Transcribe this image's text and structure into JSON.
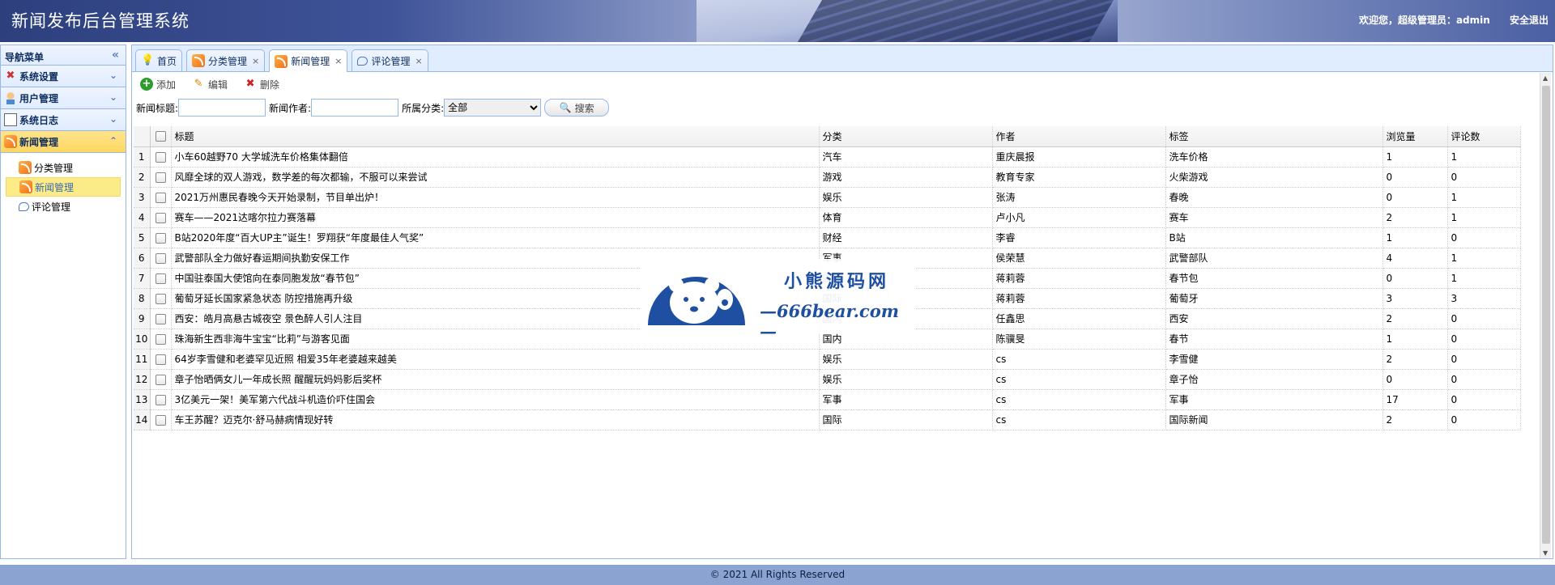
{
  "header": {
    "title": "新闻发布后台管理系统",
    "welcome": "欢迎您，超级管理员：admin",
    "logout": "安全退出"
  },
  "sidebar": {
    "title": "导航菜单",
    "sections": [
      {
        "label": "系统设置",
        "icon": "tools-icon",
        "active": false
      },
      {
        "label": "用户管理",
        "icon": "user-icon",
        "active": false
      },
      {
        "label": "系统日志",
        "icon": "log-icon",
        "active": false
      },
      {
        "label": "新闻管理",
        "icon": "rss-icon",
        "active": true
      }
    ],
    "subitems": [
      {
        "label": "分类管理",
        "icon": "rss-icon",
        "selected": false
      },
      {
        "label": "新闻管理",
        "icon": "rss-icon",
        "selected": true
      },
      {
        "label": "评论管理",
        "icon": "comment-icon",
        "selected": false
      }
    ]
  },
  "tabs": [
    {
      "label": "首页",
      "icon": "bulb-icon",
      "closable": false
    },
    {
      "label": "分类管理",
      "icon": "rss-icon",
      "closable": true
    },
    {
      "label": "新闻管理",
      "icon": "rss-icon",
      "closable": true,
      "active": true
    },
    {
      "label": "评论管理",
      "icon": "comment-icon",
      "closable": true
    }
  ],
  "toolbar": {
    "add": "添加",
    "edit": "编辑",
    "delete": "删除"
  },
  "search": {
    "title_label": "新闻标题:",
    "author_label": "新闻作者:",
    "category_label": "所属分类:",
    "category_value": "全部",
    "button": "搜索"
  },
  "table": {
    "columns": [
      "标题",
      "分类",
      "作者",
      "标签",
      "浏览量",
      "评论数"
    ],
    "rows": [
      [
        "1",
        "小车60越野70 大学城洗车价格集体翻倍",
        "汽车",
        "重庆晨报",
        "洗车价格",
        "1",
        "1"
      ],
      [
        "2",
        "风靡全球的双人游戏，数学差的每次都输，不服可以来尝试",
        "游戏",
        "教育专家",
        "火柴游戏",
        "0",
        "0"
      ],
      [
        "3",
        "2021万州惠民春晚今天开始录制，节目单出炉！",
        "娱乐",
        "张涛",
        "春晚",
        "0",
        "1"
      ],
      [
        "4",
        "赛车——2021达喀尔拉力赛落幕",
        "体育",
        "卢小凡",
        "赛车",
        "2",
        "1"
      ],
      [
        "5",
        "B站2020年度“百大UP主”诞生！罗翔获“年度最佳人气奖”",
        "财经",
        "李睿",
        "B站",
        "1",
        "0"
      ],
      [
        "6",
        "武警部队全力做好春运期间执勤安保工作",
        "军事",
        "侯荣慧",
        "武警部队",
        "4",
        "1"
      ],
      [
        "7",
        "中国驻泰国大使馆向在泰同胞发放“春节包”",
        "国际",
        "蒋莉蓉",
        "春节包",
        "0",
        "1"
      ],
      [
        "8",
        "葡萄牙延长国家紧急状态 防控措施再升级",
        "国际",
        "蒋莉蓉",
        "葡萄牙",
        "3",
        "3"
      ],
      [
        "9",
        "西安：皓月高悬古城夜空 景色醉人引人注目",
        "国内",
        "任鑫思",
        "西安",
        "2",
        "0"
      ],
      [
        "10",
        "珠海新生西非海牛宝宝“比莉”与游客见面",
        "国内",
        "陈骥旻",
        "春节",
        "1",
        "0"
      ],
      [
        "11",
        "64岁李雪健和老婆罕见近照 相爱35年老婆越来越美",
        "娱乐",
        "cs",
        "李雪健",
        "2",
        "0"
      ],
      [
        "12",
        "章子怡晒俩女儿一年成长照 醒醒玩妈妈影后奖杯",
        "娱乐",
        "cs",
        "章子怡",
        "0",
        "0"
      ],
      [
        "13",
        "3亿美元一架！美军第六代战斗机造价吓住国会",
        "军事",
        "cs",
        "军事",
        "17",
        "0"
      ],
      [
        "14",
        "车王苏醒？迈克尔·舒马赫病情现好转",
        "国际",
        "cs",
        "国际新闻",
        "2",
        "0"
      ]
    ]
  },
  "watermark": {
    "cn": "小熊源码网",
    "en": "—666bear.com—"
  },
  "footer": "© 2021 All Rights Reserved"
}
